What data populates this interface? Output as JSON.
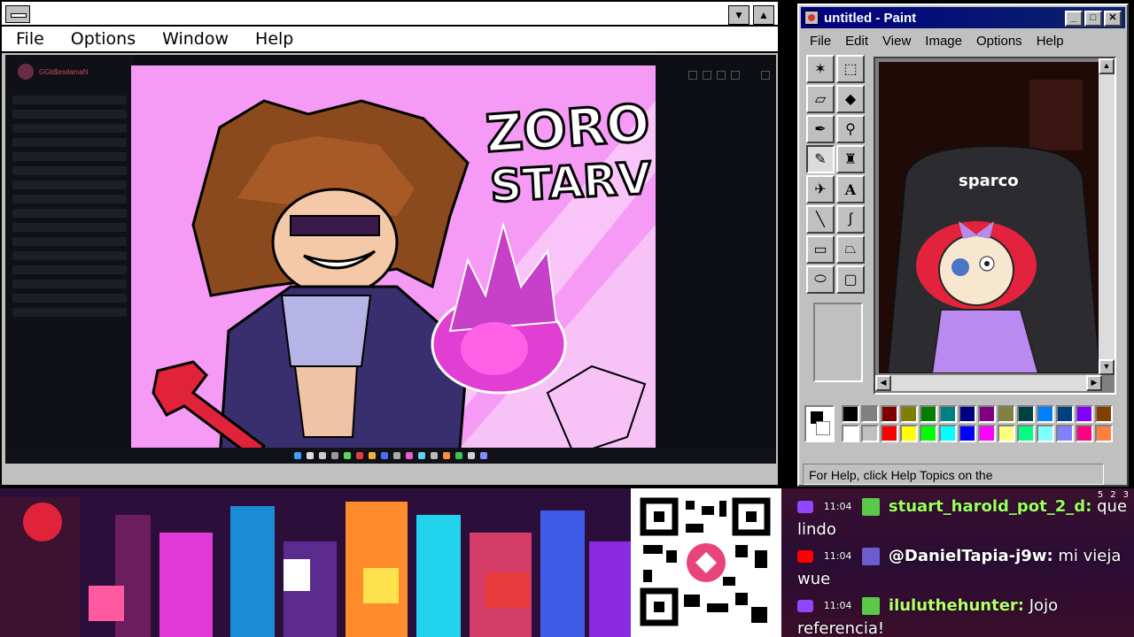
{
  "left_window": {
    "menu": [
      "File",
      "Options",
      "Window",
      "Help"
    ],
    "stream_user": "GGb$esdamaN",
    "artwork_title_lines": [
      "ZORO",
      "STARV"
    ]
  },
  "paint": {
    "title": "untitled - Paint",
    "menu": [
      "File",
      "Edit",
      "View",
      "Image",
      "Options",
      "Help"
    ],
    "tools": [
      "free-select",
      "rect-select",
      "eraser",
      "fill",
      "picker",
      "magnifier",
      "pencil",
      "brush",
      "airbrush",
      "text",
      "line",
      "curve",
      "rectangle",
      "polygon",
      "ellipse",
      "rounded-rect"
    ],
    "tool_text_glyph": "A",
    "active_tool": "pencil",
    "chair_brand": "sparco",
    "palette": [
      "#000000",
      "#808080",
      "#800000",
      "#808000",
      "#008000",
      "#008080",
      "#000080",
      "#800080",
      "#808040",
      "#004040",
      "#0080ff",
      "#004080",
      "#8000ff",
      "#804000",
      "#ffffff",
      "#c0c0c0",
      "#ff0000",
      "#ffff00",
      "#00ff00",
      "#00ffff",
      "#0000ff",
      "#ff00ff",
      "#ffff80",
      "#00ff80",
      "#80ffff",
      "#8080ff",
      "#ff0080",
      "#ff8040"
    ],
    "status": "For Help, click Help Topics on the"
  },
  "chat": {
    "counters": [
      "5",
      "2",
      "3"
    ],
    "messages": [
      {
        "platform": "twitch",
        "time": "11:04",
        "user": "stuart_harold_pot_2_d:",
        "text": "que lindo"
      },
      {
        "platform": "youtube",
        "time": "11:04",
        "user": "@DanielTapia-j9w:",
        "text": "mi vieja wue"
      },
      {
        "platform": "twitch",
        "time": "11:04",
        "user": "iluluthehunter:",
        "text": "Jojo referencia!"
      }
    ]
  },
  "colors": {
    "twitch": "#9146ff",
    "youtube": "#ff0000",
    "chat_name": "#9cff5c"
  }
}
